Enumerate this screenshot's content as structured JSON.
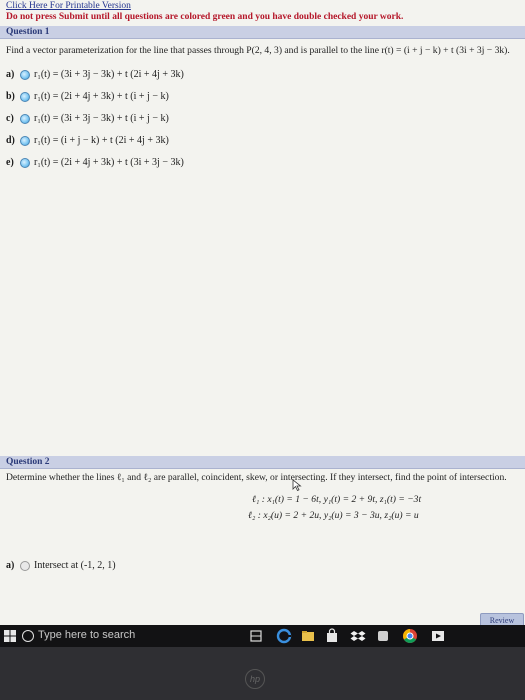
{
  "header": {
    "printable_link": "Click Here For Printable Version",
    "warning": "Do not press Submit until all questions are colored green and you have double checked your work."
  },
  "question1": {
    "title": "Question 1",
    "prompt": "Find a vector parameterization for the line that passes through P(2, 4, 3) and is parallel to the line r(t) = (i + j − k) + t (3i + 3j − 3k).",
    "options": [
      {
        "letter": "a)",
        "text": "r₁(t) = (3i + 3j − 3k) + t (2i + 4j + 3k)"
      },
      {
        "letter": "b)",
        "text": "r₁(t) = (2i + 4j + 3k) + t (i + j − k)"
      },
      {
        "letter": "c)",
        "text": "r₁(t) = (3i + 3j − 3k) + t (i + j − k)"
      },
      {
        "letter": "d)",
        "text": "r₁(t) = (i + j − k) + t (2i + 4j + 3k)"
      },
      {
        "letter": "e)",
        "text": "r₁(t) = (2i + 4j + 3k) + t (3i + 3j − 3k)"
      }
    ]
  },
  "question2": {
    "title": "Question 2",
    "prompt": "Determine whether the lines ℓ₁ and ℓ₂ are parallel, coincident, skew, or intersecting. If they intersect, find the point of intersection.",
    "eq1": "ℓ₁ : x₁(t) = 1 − 6t, y₁(t) = 2 + 9t, z₁(t) = −3t",
    "eq2": "ℓ₂ : x₂(u) = 2 + 2u, y₂(u) = 3 − 3u, z₂(u) = u",
    "option_a": {
      "letter": "a)",
      "text": "Intersect at (-1, 2, 1)"
    }
  },
  "review_button": "Review",
  "taskbar": {
    "search_placeholder": "Type here to search",
    "icons": [
      "windows-start-icon",
      "task-view-icon",
      "edge-icon",
      "file-explorer-icon",
      "store-icon",
      "dropbox-icon",
      "app-icon",
      "chrome-icon",
      "media-icon"
    ]
  },
  "bezel": {
    "logo": "hp"
  }
}
